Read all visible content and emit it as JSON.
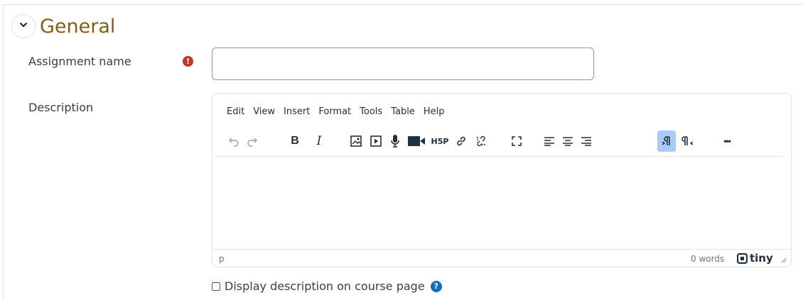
{
  "section": {
    "title": "General",
    "collapse_icon": "chevron-down-icon"
  },
  "fields": {
    "assignment_name": {
      "label": "Assignment name",
      "value": "",
      "required": true,
      "required_icon": "exclamation-circle-icon"
    },
    "description": {
      "label": "Description"
    }
  },
  "editor": {
    "menu": [
      "Edit",
      "View",
      "Insert",
      "Format",
      "Tools",
      "Table",
      "Help"
    ],
    "toolbar": {
      "h5p_label": "H5P",
      "icons": [
        "undo-icon",
        "redo-icon",
        "bold-icon",
        "italic-icon",
        "image-icon",
        "media-icon",
        "record-audio-icon",
        "record-video-icon",
        "h5p-icon",
        "link-icon",
        "unlink-icon",
        "fullscreen-icon",
        "align-left-icon",
        "align-center-icon",
        "align-right-icon",
        "ltr-icon",
        "rtl-icon",
        "more-icon"
      ],
      "bold_label": "B",
      "italic_label": "I",
      "more_label": "•••"
    },
    "status": {
      "path": "p",
      "word_count": "0 words",
      "brand": "tiny"
    }
  },
  "display_description": {
    "label": "Display description on course page",
    "checked": false,
    "help_icon": "question-circle-icon"
  },
  "colors": {
    "section_title": "#8a5a14",
    "required": "#ca3120",
    "help": "#0f6cbf",
    "active_tool": "#a6ccf7"
  }
}
